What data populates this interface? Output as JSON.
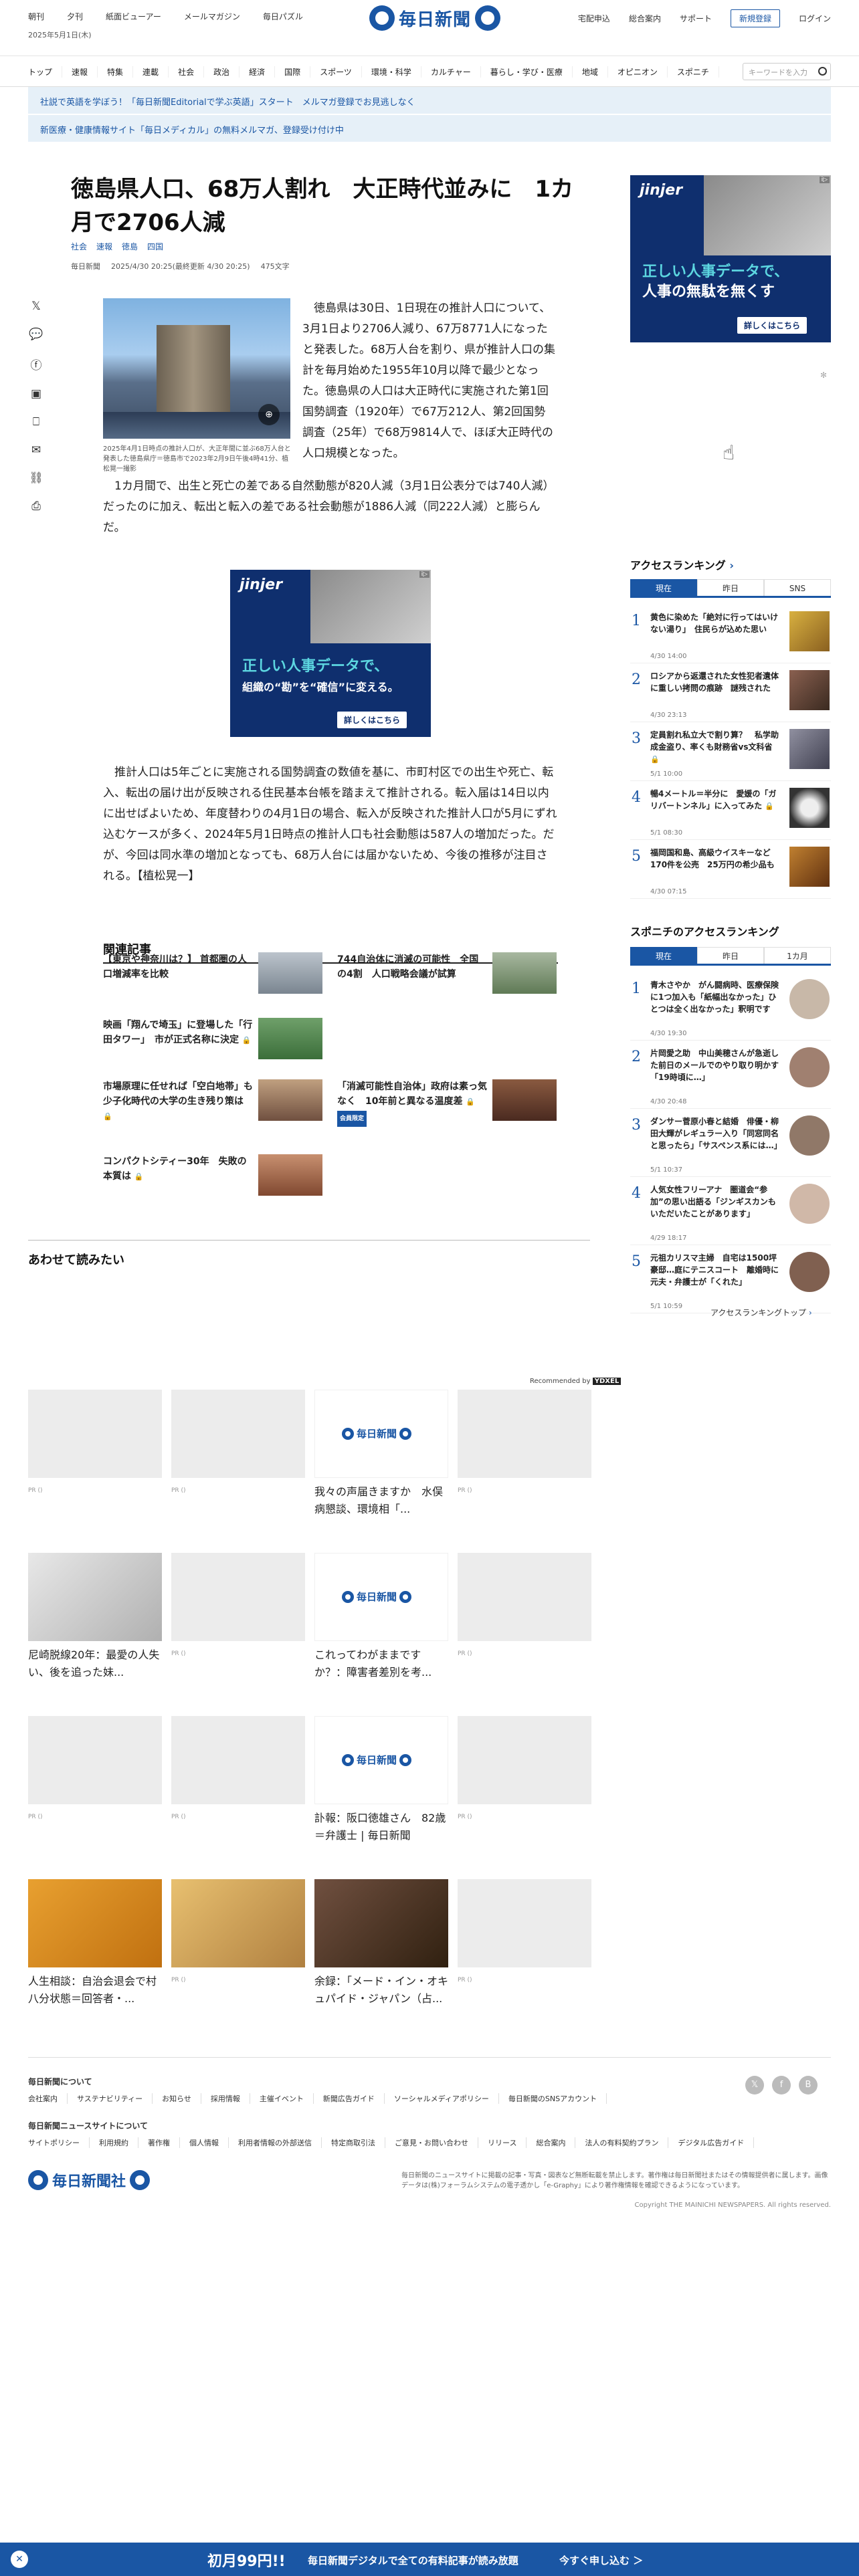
{
  "header": {
    "nav_left": [
      "朝刊",
      "夕刊",
      "紙面ビューアー",
      "メールマガジン",
      "毎日パズル"
    ],
    "date": "2025年5月1日(木)",
    "logo": "毎日新聞",
    "nav_right": [
      "宅配申込",
      "総合案内",
      "サポート"
    ],
    "register": "新規登録",
    "login": "ログイン"
  },
  "categories": [
    "トップ",
    "速報",
    "特集",
    "連載",
    "社会",
    "政治",
    "経済",
    "国際",
    "スポーツ",
    "環境・科学",
    "カルチャー",
    "暮らし・学び・医療",
    "地域",
    "オピニオン",
    "スポニチ"
  ],
  "search": {
    "placeholder": "キーワードを入力"
  },
  "notices": [
    "社説で英語を学ぼう！「毎日新聞Editorialで学ぶ英語」スタート　メルマガ登録でお見逃しなく",
    "新医療・健康情報サイト「毎日メディカル」の無料メルマガ、登録受け付け中"
  ],
  "article": {
    "title": "徳島県人口、68万人割れ　大正時代並みに　1カ月で2706人減",
    "tags": [
      "社会",
      "速報",
      "徳島",
      "四国"
    ],
    "meta": {
      "source": "毎日新聞",
      "date": "2025/4/30 20:25(最終更新 4/30 20:25)",
      "chars": "475文字"
    },
    "caption": "2025年4月1日時点の推計人口が、大正年間に並ぶ68万人台と発表した徳島県庁＝徳島市で2023年2月9日午後4時41分、植松晃一撮影",
    "p1": "　徳島県は30日、1日現在の推計人口について、3月1日より2706人減り、67万8771人になったと発表した。68万人台を割り、県が推計人口の集計を毎月始めた1955年10月以降で最少となった。徳島県の人口は大正時代に実施された第1回国勢調査（1920年）で67万212人、第2回国勢調査（25年）で68万9814人で、ほぼ大正時代の人口規模となった。",
    "p2": "　1カ月間で、出生と死亡の差である自然動態が820人減（3月1日公表分では740人減）だったのに加え、転出と転入の差である社会動態が1886人減（同222人減）と膨らんだ。",
    "p3": "　推計人口は5年ごとに実施される国勢調査の数値を基に、市町村区での出生や死亡、転入、転出の届け出が反映される住民基本台帳を踏まえて推計される。転入届は14日以内に出せばよいため、年度替わりの4月1日の場合、転入が反映された推計人口が5月にずれ込むケースが多く、2024年5月1日時点の推計人口も社会動態は587人の増加だった。だが、今回は同水準の増加となっても、68万人台には届かないため、今後の推移が注目される。【植松晃一】"
  },
  "ad": {
    "brand": "jinjer",
    "side_line1": "正しい人事データで、",
    "side_line2": "人事の無駄を無くす",
    "mid_line1": "正しい人事データで、",
    "mid_line2": "組織の“勘”を“確信”に変える。",
    "cta": "詳しくはこちら"
  },
  "related": {
    "heading": "関連記事",
    "items": [
      {
        "title": "【東京や神奈川は？】 首都圏の人口増減率を比較"
      },
      {
        "title": "744自治体に消滅の可能性　全国の4割　人口戦略会議が試算"
      },
      {
        "title": "映画「翔んで埼玉」に登場した「行田タワー」　市が正式名称に決定"
      },
      {
        "title": "市場原理に任せれば「空白地帯」も　少子化時代の大学の生き残り策は"
      },
      {
        "title": "「消滅可能性自治体」政府は素っ気なく　10年前と異なる温度差",
        "badge": "会員限定"
      },
      {
        "title": "コンパクトシティー30年　失敗の本質は"
      }
    ]
  },
  "ranking": {
    "title": "アクセスランキング",
    "tabs": [
      "現在",
      "昨日",
      "SNS"
    ],
    "items": [
      {
        "rank": "1",
        "text": "黄色に染めた「絶対に行ってはいけない湯り」　住民らが込めた思い",
        "date": "4/30 14:00"
      },
      {
        "rank": "2",
        "text": "ロシアから返還された女性犯者遺体に重しい拷問の痕跡　謎残された",
        "date": "4/30 23:13"
      },
      {
        "rank": "3",
        "text": "定員割れ私立大で割り算？　私学助成金盗り、率くも財務省vs文科省",
        "date": "5/1 10:00"
      },
      {
        "rank": "4",
        "text": "暢4メートル＝半分に　愛媛の「ガリバートンネル」に入ってみた",
        "date": "5/1 08:30"
      },
      {
        "rank": "5",
        "text": "福岡国和島、高級ウイスキーなど170件を公売　25万円の希少品も",
        "date": "4/30 07:15"
      }
    ]
  },
  "sponichi": {
    "title": "スポニチのアクセスランキング",
    "tabs": [
      "現在",
      "昨日",
      "1カ月"
    ],
    "items": [
      {
        "rank": "1",
        "text": "青木さやか　がん闘病時、医療保険に1つ加入も「紙幅出なかった」ひとつは全く出なかった」釈明です",
        "date": "4/30 19:30"
      },
      {
        "rank": "2",
        "text": "片岡愛之助　中山美穂さんが急逝した前日のメールでのやり取り明かす「19時頃に…」",
        "date": "4/30 20:48"
      },
      {
        "rank": "3",
        "text": "ダンサー菅原小春と結婚　俳優・柳田大輝がレギュラー入り「同窓同名と思ったら」「サスペンス系には…」",
        "date": "5/1 10:37"
      },
      {
        "rank": "4",
        "text": "人気女性フリーアナ　圏道会“参加”の思い出語る「ジンギスカンもいただいたことがあります」",
        "date": "4/29 18:17"
      },
      {
        "rank": "5",
        "text": "元祖カリスマ主婦　自宅は1500坪豪邸…庭にテニスコート　離婚時に元夫・弁護士が「くれた」",
        "date": "5/1 10:59"
      }
    ],
    "more": "アクセスランキングトップ"
  },
  "read_together": {
    "heading": "あわせて読みたい",
    "recommended": "Recommended by",
    "pr": "PR ()",
    "cards": [
      {
        "title": ""
      },
      {
        "title": ""
      },
      {
        "title": "我々の声届きますか　水俣病懇談、環境相「..."
      },
      {
        "title": ""
      },
      {
        "title": "尼崎脱線20年：最愛の人失い、後を追った妹..."
      },
      {
        "title": ""
      },
      {
        "title": "これってわがままですか？：障害者差別を考..."
      },
      {
        "title": ""
      },
      {
        "title": ""
      },
      {
        "title": ""
      },
      {
        "title": "訃報：阪口徳雄さん　82歳＝弁護士 | 毎日新聞"
      },
      {
        "title": ""
      },
      {
        "title": "人生相談：自治会退会で村八分状態＝回答者・..."
      },
      {
        "title": ""
      },
      {
        "title": "余録：「メード・イン・オキュパイド・ジャパン（占..."
      },
      {
        "title": ""
      }
    ]
  },
  "footer": {
    "h1": "毎日新聞について",
    "links1": [
      "会社案内",
      "サステナビリティー",
      "お知らせ",
      "採用情報",
      "主催イベント",
      "新聞広告ガイド",
      "ソーシャルメディアポリシー",
      "毎日新聞のSNSアカウント"
    ],
    "h2": "毎日新聞ニュースサイトについて",
    "links2": [
      "サイトポリシー",
      "利用規約",
      "著作権",
      "個人情報",
      "利用者情報の外部送信",
      "特定商取引法",
      "ご意見・お問い合わせ",
      "リリース",
      "総合案内",
      "法人の有料契約プラン",
      "デジタル広告ガイド"
    ],
    "corp": "毎日新聞社",
    "note": "毎日新聞のニュースサイトに掲載の記事・写真・図表など無断転載を禁止します。著作権は毎日新聞社またはその情報提供者に属します。画像データは(株)フォーラムシステムの電子透かし「e-Graphy」により著作権情報を確認できるようになっています。",
    "copyright": "Copyright THE MAINICHI NEWSPAPERS. All rights reserved."
  },
  "bottom_bar": {
    "price": "初月99円!!",
    "text": "毎日新聞デジタルで全ての有料記事が読み放題",
    "cta": "今すぐ申し込む ＞"
  },
  "colors": {
    "brand": "#1a56a4",
    "notice_bg": "#e6f0f8"
  }
}
